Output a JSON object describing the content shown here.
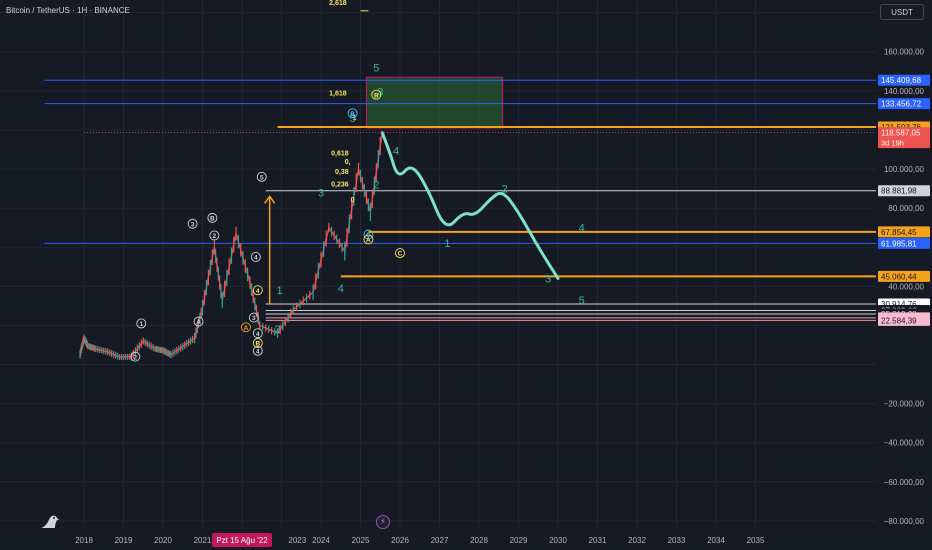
{
  "header": {
    "title": "Bitcoin / TetherUS · 1H · BINANCE",
    "currency_button": "USDT"
  },
  "colors": {
    "background": "#161a25",
    "grid": "#232632",
    "axis_text": "#b2b5be",
    "projection": "#7ee0c8",
    "elliptic_wave": "#3ab794",
    "orange": "#f7a21b",
    "blue": "#2962ff",
    "candle_up": "#26a69a",
    "candle_down": "#ef5350"
  },
  "chart_data": {
    "type": "line",
    "x_unit": "year",
    "x_ticks": [
      "2018",
      "2019",
      "2020",
      "2021",
      "2023",
      "2024",
      "2025",
      "2026",
      "2027",
      "2028",
      "2029",
      "2030",
      "2031",
      "2032",
      "2033",
      "2034",
      "2035"
    ],
    "crosshair_date": "Pzt 15 Ağu '22",
    "y_ticks": [
      "160.000,00",
      "140.000,00",
      "100.000,00",
      "80.000,00",
      "40.000,00",
      "−20.000,00",
      "−40.000,00",
      "−60.000,00",
      "−80.000,00"
    ],
    "price_history": [
      [
        2017.9,
        5200
      ],
      [
        2018.0,
        13500
      ],
      [
        2018.1,
        9500
      ],
      [
        2018.3,
        8000
      ],
      [
        2018.6,
        6500
      ],
      [
        2018.9,
        3800
      ],
      [
        2019.2,
        4000
      ],
      [
        2019.5,
        12000
      ],
      [
        2019.8,
        8000
      ],
      [
        2020.0,
        7200
      ],
      [
        2020.2,
        5000
      ],
      [
        2020.5,
        9200
      ],
      [
        2020.8,
        13500
      ],
      [
        2021.0,
        29000
      ],
      [
        2021.3,
        60000
      ],
      [
        2021.5,
        33000
      ],
      [
        2021.85,
        67000
      ],
      [
        2022.2,
        42000
      ],
      [
        2022.45,
        20000
      ],
      [
        2022.9,
        16000
      ],
      [
        2023.3,
        28000
      ],
      [
        2023.8,
        37000
      ],
      [
        2024.2,
        70000
      ],
      [
        2024.6,
        58000
      ],
      [
        2024.95,
        100000
      ],
      [
        2025.25,
        78000
      ],
      [
        2025.55,
        118587
      ]
    ],
    "projection": [
      [
        2025.55,
        118587
      ],
      [
        2025.75,
        108000
      ],
      [
        2025.95,
        95000
      ],
      [
        2026.3,
        103000
      ],
      [
        2026.7,
        90000
      ],
      [
        2027.15,
        68000
      ],
      [
        2027.6,
        78000
      ],
      [
        2027.9,
        76000
      ],
      [
        2028.3,
        85000
      ],
      [
        2028.6,
        89000
      ],
      [
        2029.0,
        78000
      ],
      [
        2029.5,
        60000
      ],
      [
        2030.0,
        44000
      ]
    ],
    "orange_arrow": [
      [
        2022.7,
        31000
      ],
      [
        2022.7,
        86000
      ]
    ],
    "horizontal_levels": [
      {
        "price": 145409.68,
        "label": "145.409,68",
        "color": "#2962ff",
        "badge": "#2962ff",
        "start": 2017.0
      },
      {
        "price": 133456.72,
        "label": "133.456,72",
        "color": "#2962ff",
        "badge": "#2962ff",
        "start": 2017.0
      },
      {
        "price": 121503.76,
        "label": "121.503,76",
        "color": "#f7a21b",
        "badge": "#f7a21b",
        "start": 2022.9
      },
      {
        "price": 88881.98,
        "label": "88.881,98",
        "color": "#d1d4dc",
        "badge": "#d1d4dc",
        "start": 2022.6
      },
      {
        "price": 67854.45,
        "label": "67.854,45",
        "color": "#f7a21b",
        "badge": "#f7a21b",
        "start": 2025.2
      },
      {
        "price": 61985.81,
        "label": "61.985,81",
        "color": "#2962ff",
        "badge": "#2962ff",
        "start": 2017.0
      },
      {
        "price": 45060.44,
        "label": "45.060,44",
        "color": "#f7a21b",
        "badge": "#f7a21b",
        "start": 2024.5
      },
      {
        "price": 30914.76,
        "label": "30.914,76",
        "color": "#d1d4dc",
        "badge": "#ffffff",
        "start": 2022.6
      },
      {
        "price": 27617.36,
        "label": "27.617,36",
        "color": "#26a69a",
        "badge": "#26a69a",
        "start": 2022.6
      },
      {
        "price": 27602.66,
        "label": "27.602,66",
        "color": "#d1d4dc",
        "badge": "#161a25",
        "start": 2022.6
      },
      {
        "price": 25813.28,
        "label": "25.813,28",
        "color": "#d1d4dc",
        "badge": "#161a25",
        "start": 2022.6
      },
      {
        "price": 23839.83,
        "label": "23.839,83",
        "color": "#ef9a9a",
        "badge": "#f8bbd0",
        "start": 2022.6
      },
      {
        "price": 22584.39,
        "label": "22.584,39",
        "color": "#ef9a9a",
        "badge": "#f8bbd0",
        "start": 2022.6
      }
    ],
    "current_price": {
      "price": 118587.05,
      "label": "118.587,05",
      "countdown": "3d 19h"
    },
    "target_box": {
      "x0": 2025.15,
      "x1": 2028.6,
      "y0": 121000,
      "y1": 147000
    },
    "fib_labels": [
      {
        "x": 2024.65,
        "y": 184000,
        "text": "2,618"
      },
      {
        "x": 2024.65,
        "y": 137500,
        "text": "1,618"
      },
      {
        "x": 2024.7,
        "y": 107000,
        "text": "0,618"
      },
      {
        "x": 2024.75,
        "y": 102500,
        "text": "0,"
      },
      {
        "x": 2024.7,
        "y": 97500,
        "text": "0,38"
      },
      {
        "x": 2024.7,
        "y": 91000,
        "text": "0,236"
      },
      {
        "x": 2024.85,
        "y": 83000,
        "text": "0"
      },
      {
        "x": 2024.9,
        "y": 125000,
        "text": "1"
      }
    ],
    "wave_labels": [
      {
        "x": 2025.4,
        "y": 150000,
        "text": "5",
        "color": "#3ab794"
      },
      {
        "x": 2025.5,
        "y": 137500,
        "text": "3",
        "color": "#3ab794"
      },
      {
        "x": 2024.8,
        "y": 124000,
        "text": "5",
        "color": "#3ab794"
      },
      {
        "x": 2025.9,
        "y": 107500,
        "text": "4",
        "color": "#3ab794"
      },
      {
        "x": 2025.4,
        "y": 90000,
        "text": "2",
        "color": "#3ab794"
      },
      {
        "x": 2024.0,
        "y": 86000,
        "text": "3",
        "color": "#3ab794"
      },
      {
        "x": 2022.95,
        "y": 36000,
        "text": "1",
        "color": "#3ab794"
      },
      {
        "x": 2024.5,
        "y": 37000,
        "text": "4",
        "color": "#3ab794"
      },
      {
        "x": 2022.9,
        "y": 16000,
        "text": "2",
        "color": "#3ab794"
      },
      {
        "x": 2028.65,
        "y": 88000,
        "text": "2",
        "color": "#3ab794"
      },
      {
        "x": 2027.2,
        "y": 60000,
        "text": "1",
        "color": "#3ab794"
      },
      {
        "x": 2030.6,
        "y": 68000,
        "text": "4",
        "color": "#3ab794"
      },
      {
        "x": 2029.75,
        "y": 42000,
        "text": "3",
        "color": "#3ab794"
      },
      {
        "x": 2030.6,
        "y": 31000,
        "text": "5",
        "color": "#3ab794"
      }
    ],
    "circle_labels": [
      {
        "x": 2019.45,
        "y": 21000,
        "text": "1",
        "color": "#d1d4dc"
      },
      {
        "x": 2019.3,
        "y": 4000,
        "text": "2",
        "color": "#d1d4dc"
      },
      {
        "x": 2020.75,
        "y": 72000,
        "text": "3",
        "color": "#d1d4dc"
      },
      {
        "x": 2021.25,
        "y": 75000,
        "text": "B",
        "color": "#d1d4dc"
      },
      {
        "x": 2021.3,
        "y": 66000,
        "text": "2",
        "color": "#d1d4dc"
      },
      {
        "x": 2020.9,
        "y": 22000,
        "text": "A",
        "color": "#d1d4dc"
      },
      {
        "x": 2022.5,
        "y": 96000,
        "text": "5",
        "color": "#d1d4dc"
      },
      {
        "x": 2024.8,
        "y": 128500,
        "text": "B",
        "color": "#4fc3f7"
      },
      {
        "x": 2025.4,
        "y": 138000,
        "text": "B",
        "color": "#f5e663"
      },
      {
        "x": 2025.2,
        "y": 66500,
        "text": "C",
        "color": "#4fc3f7"
      },
      {
        "x": 2025.2,
        "y": 64000,
        "text": "A",
        "color": "#f5e663"
      },
      {
        "x": 2026.0,
        "y": 57000,
        "text": "C",
        "color": "#f5e663"
      },
      {
        "x": 2022.35,
        "y": 55000,
        "text": "4",
        "color": "#d1d4dc"
      },
      {
        "x": 2022.4,
        "y": 38000,
        "text": "4",
        "color": "#f5e663"
      },
      {
        "x": 2022.3,
        "y": 24000,
        "text": "3",
        "color": "#d1d4dc"
      },
      {
        "x": 2022.4,
        "y": 16000,
        "text": "4",
        "color": "#d1d4dc"
      },
      {
        "x": 2022.4,
        "y": 11000,
        "text": "B",
        "color": "#f5e663"
      },
      {
        "x": 2022.4,
        "y": 7000,
        "text": "4",
        "color": "#d1d4dc"
      },
      {
        "x": 2022.1,
        "y": 19000,
        "text": "A",
        "color": "#f7a21b"
      }
    ]
  }
}
